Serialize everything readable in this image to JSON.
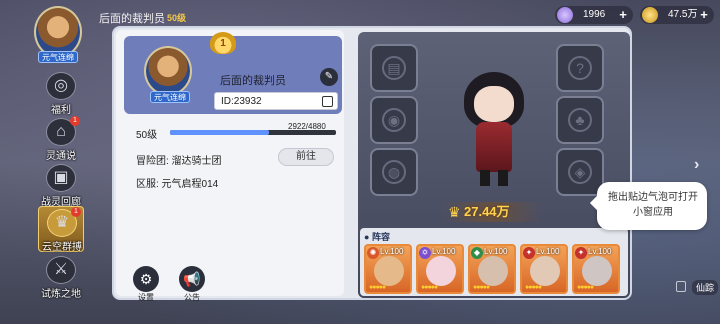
{
  "top": {
    "player_name": "后面的裁判员",
    "level": "50级",
    "avatar_tag": "元气连绵",
    "gems": "1996",
    "coins": "47.5万"
  },
  "sidenav": [
    {
      "label": "福利",
      "badge": ""
    },
    {
      "label": "灵通说",
      "badge": "1"
    },
    {
      "label": "战灵回廊",
      "badge": ""
    },
    {
      "label": "云空群搏",
      "badge": "1"
    },
    {
      "label": "试炼之地",
      "badge": ""
    }
  ],
  "profile": {
    "rank": "1",
    "avatar_tag": "元气连绵",
    "name": "后面的裁判员",
    "id": "ID:23932",
    "level": "50级",
    "exp_text": "2922/4880",
    "exp_ratio": 0.599,
    "adventure_group": "冒险团: 溜达骑士团",
    "goto_label": "前往",
    "server": "区服: 元气启程014",
    "settings_label": "设置",
    "notice_label": "公告"
  },
  "hero": {
    "power": "27.44万",
    "lineup_title": "阵容",
    "cards": [
      {
        "level": "Lv.100",
        "badge_color": "#d8582a"
      },
      {
        "level": "Lv.100",
        "badge_color": "#7c4fd0"
      },
      {
        "level": "Lv.100",
        "badge_color": "#2f8f4a"
      },
      {
        "level": "Lv.100",
        "badge_color": "#c5312b"
      },
      {
        "level": "Lv.100",
        "badge_color": "#c5312b"
      }
    ]
  },
  "tooltip": {
    "text": "拖出贴边气泡可打开小窗应用"
  },
  "corner": {
    "label": "仙踪"
  }
}
